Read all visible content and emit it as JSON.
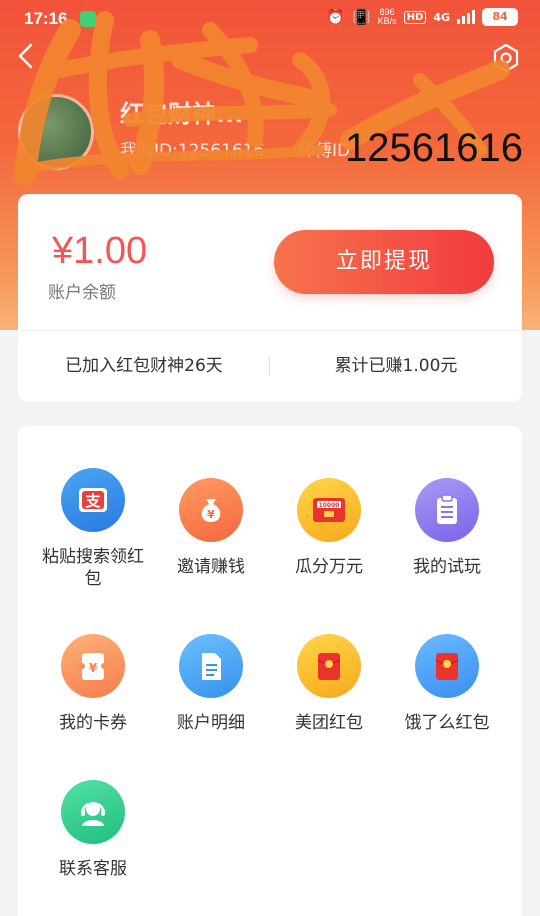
{
  "status_bar": {
    "time": "17:16",
    "net_speed_top": "896",
    "net_speed_bottom": "KB/s",
    "hd": "HD",
    "network": "4G",
    "battery": "84"
  },
  "profile": {
    "username": "红包财神...",
    "my_id_label": "我的ID:12561616",
    "master_label": "师傅ID",
    "overlay_id": "12561616"
  },
  "balance": {
    "amount": "¥1.00",
    "label": "账户余额",
    "withdraw_button": "立即提现",
    "joined_days": "已加入红包财神26天",
    "earned_total": "累计已赚1.00元"
  },
  "menu": {
    "items": [
      {
        "label": "粘贴搜索领红包",
        "icon": "alipay-icon"
      },
      {
        "label": "邀请赚钱",
        "icon": "money-bag-icon"
      },
      {
        "label": "瓜分万元",
        "icon": "red-envelope-10000-icon"
      },
      {
        "label": "我的试玩",
        "icon": "clipboard-icon"
      },
      {
        "label": "我的卡券",
        "icon": "coupon-icon"
      },
      {
        "label": "账户明细",
        "icon": "document-icon"
      },
      {
        "label": "美团红包",
        "icon": "meituan-red-envelope-icon"
      },
      {
        "label": "饿了么红包",
        "icon": "eleme-red-envelope-icon"
      },
      {
        "label": "联系客服",
        "icon": "customer-service-icon"
      }
    ]
  },
  "colors": {
    "header_top": "#f2533a",
    "header_bottom": "#f8b27a",
    "accent_red": "#f25656",
    "button_start": "#f7734c",
    "button_end": "#f23a3f"
  }
}
